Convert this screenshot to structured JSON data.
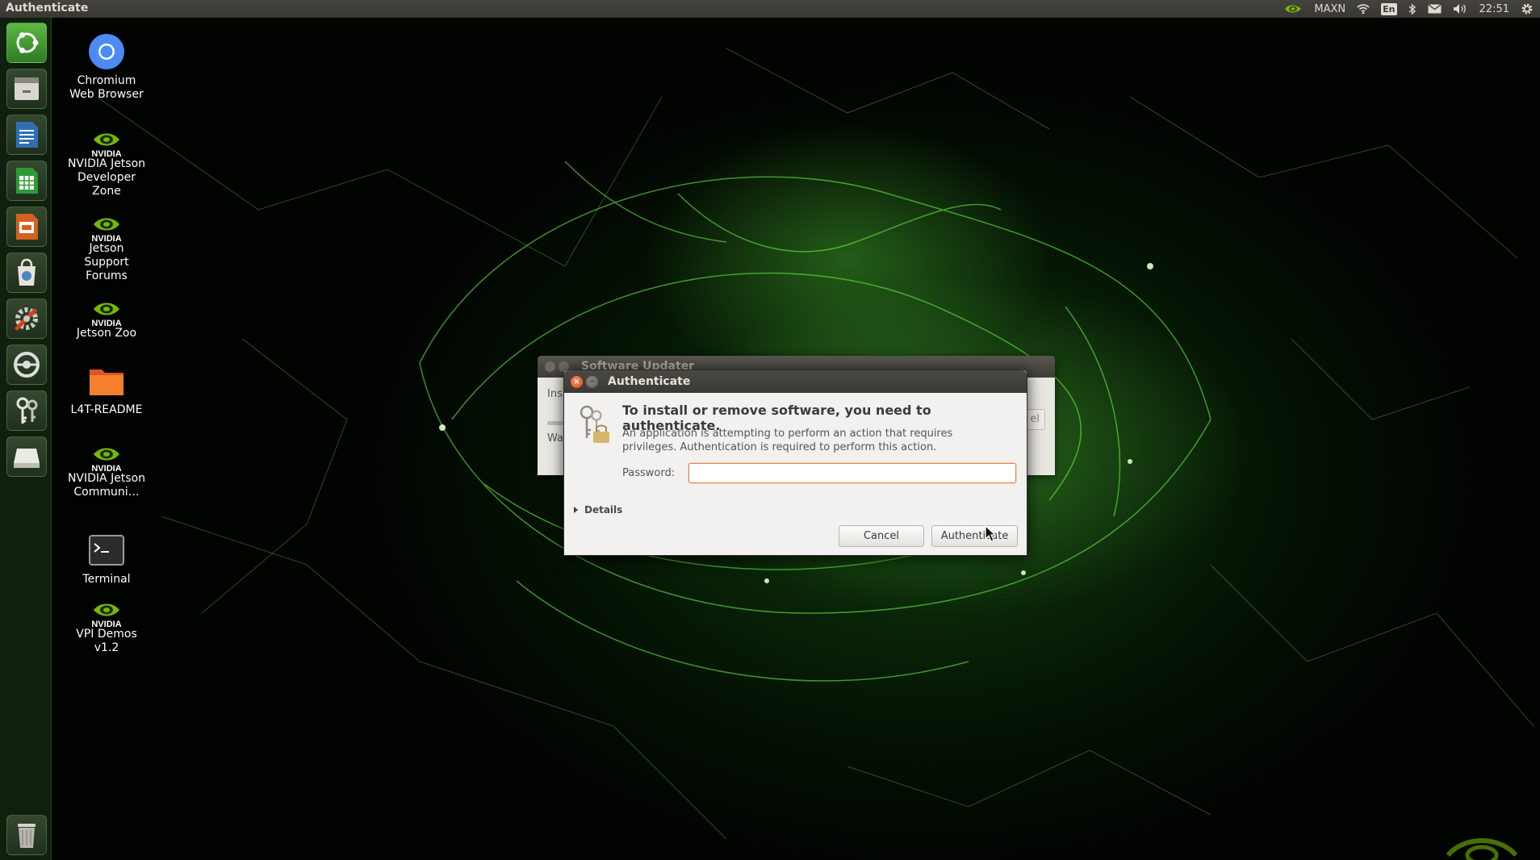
{
  "top_panel": {
    "title": "Authenticate",
    "power_mode": "MAXN",
    "keyboard_layout": "En",
    "clock": "22:51",
    "icons": [
      "nvidia-icon",
      "wifi-icon",
      "keyboard-icon",
      "bluetooth-icon",
      "mail-icon",
      "volume-icon",
      "gear-icon"
    ]
  },
  "launcher": {
    "items": [
      "ubuntu-dash-icon",
      "files-icon",
      "libreoffice-writer-icon",
      "libreoffice-calc-icon",
      "libreoffice-impress-icon",
      "software-center-icon",
      "system-settings-icon",
      "software-updater-icon",
      "keyring-icon",
      "disk-drive-icon",
      "trash-icon"
    ]
  },
  "desktop": {
    "icons": [
      {
        "label": "Chromium Web Browser"
      },
      {
        "label": "NVIDIA Jetson Developer Zone",
        "badge": "NVIDIA"
      },
      {
        "label": "Jetson Support Forums",
        "badge": "NVIDIA"
      },
      {
        "label": "Jetson Zoo",
        "badge": "NVIDIA"
      },
      {
        "label": "L4T-README"
      },
      {
        "label": "NVIDIA Jetson Communi…",
        "badge": "NVIDIA"
      },
      {
        "label": "Terminal"
      },
      {
        "label": "VPI Demos v1.2",
        "badge": "NVIDIA"
      }
    ]
  },
  "software_updater": {
    "title": "Software Updater",
    "line1": "Ins",
    "line2": "Wai",
    "button_partial": "el"
  },
  "auth_dialog": {
    "title": "Authenticate",
    "heading": "To install or remove software, you need to authenticate.",
    "description": "An application is attempting to perform an action that requires privileges. Authentication is required to perform this action.",
    "password_label": "Password:",
    "password_value": "",
    "details_label": "Details",
    "cancel_label": "Cancel",
    "authenticate_label": "Authenticate"
  },
  "colors": {
    "accent_orange": "#df4a16",
    "panel_dark": "#3a3935",
    "nvidia_green": "#76b900"
  }
}
